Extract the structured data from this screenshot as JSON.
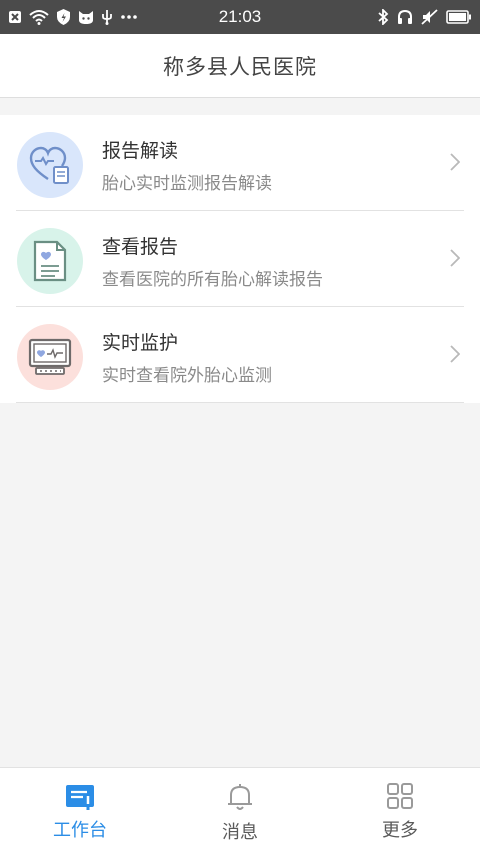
{
  "status_bar": {
    "time": "21:03",
    "left_icons": [
      "close-box-icon",
      "wifi-icon",
      "shield-icon",
      "cat-icon",
      "usb-icon",
      "more-dots-icon"
    ],
    "right_icons": [
      "bluetooth-icon",
      "headphones-icon",
      "mute-icon",
      "battery-icon"
    ]
  },
  "header": {
    "title": "称多县人民医院"
  },
  "menu": {
    "items": [
      {
        "title": "报告解读",
        "subtitle": "胎心实时监测报告解读",
        "icon": "heart-report-icon",
        "icon_bg": "#d9e6fb",
        "icon_color": "#6f8fc9"
      },
      {
        "title": "查看报告",
        "subtitle": "查看医院的所有胎心解读报告",
        "icon": "document-icon",
        "icon_bg": "#d8f3ea",
        "icon_color": "#6a8f83"
      },
      {
        "title": "实时监护",
        "subtitle": "实时查看院外胎心监测",
        "icon": "monitor-icon",
        "icon_bg": "#fce0dc",
        "icon_color": "#7c6f6f"
      }
    ]
  },
  "tab_bar": {
    "tabs": [
      {
        "label": "工作台",
        "icon": "workbench-icon",
        "active": true
      },
      {
        "label": "消息",
        "icon": "bell-icon",
        "active": false
      },
      {
        "label": "更多",
        "icon": "grid-icon",
        "active": false
      }
    ],
    "active_color": "#2b8de6"
  }
}
